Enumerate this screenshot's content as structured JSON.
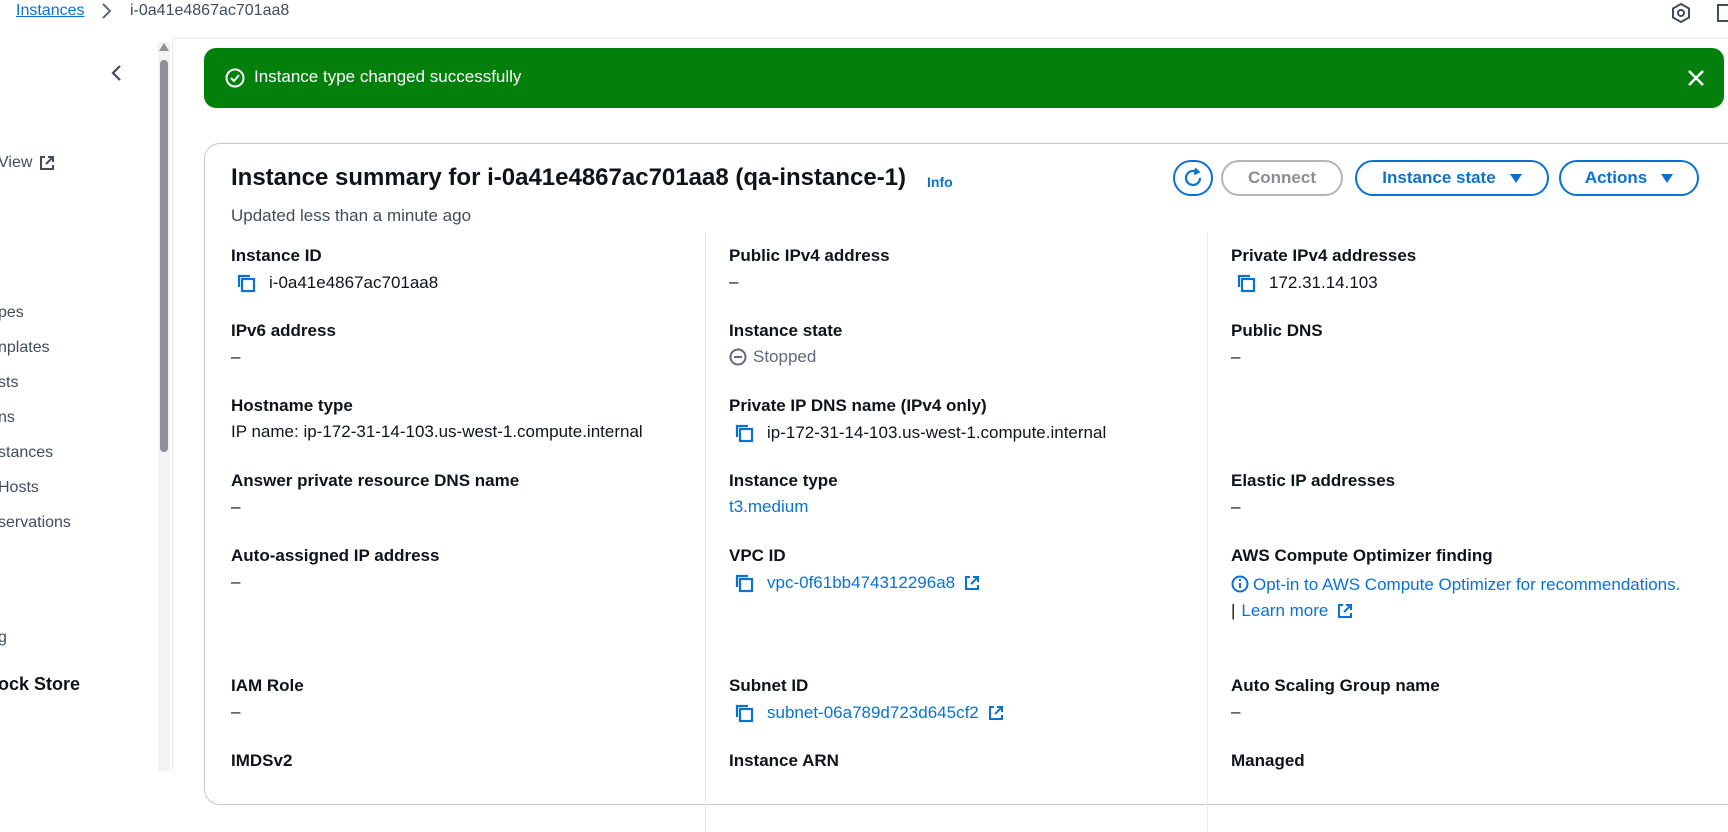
{
  "breadcrumb": {
    "parent": "Instances",
    "current": "i-0a41e4867ac701aa8"
  },
  "sidebar": {
    "items": [
      "View",
      "pes",
      "nplates",
      "sts",
      "ns",
      "stances",
      "Hosts",
      "servations",
      "g",
      "ock Store"
    ]
  },
  "flash": {
    "message": "Instance type changed successfully",
    "color": "#037f0c"
  },
  "summary": {
    "title": "Instance summary for i-0a41e4867ac701aa8 (qa-instance-1)",
    "info": "Info",
    "updated": "Updated less than a minute ago",
    "buttons": {
      "connect": "Connect",
      "instance_state": "Instance state",
      "actions": "Actions"
    },
    "fields": {
      "instance_id": {
        "label": "Instance ID",
        "value": "i-0a41e4867ac701aa8"
      },
      "public_ipv4": {
        "label": "Public IPv4 address",
        "value": "–"
      },
      "private_ipv4": {
        "label": "Private IPv4 addresses",
        "value": "172.31.14.103"
      },
      "ipv6": {
        "label": "IPv6 address",
        "value": "–"
      },
      "instance_state": {
        "label": "Instance state",
        "value": "Stopped"
      },
      "public_dns": {
        "label": "Public DNS",
        "value": "–"
      },
      "hostname_type": {
        "label": "Hostname type",
        "value": "IP name: ip-172-31-14-103.us-west-1.compute.internal"
      },
      "private_dns": {
        "label": "Private IP DNS name (IPv4 only)",
        "value": "ip-172-31-14-103.us-west-1.compute.internal"
      },
      "answer_dns": {
        "label": "Answer private resource DNS name",
        "value": "–"
      },
      "instance_type": {
        "label": "Instance type",
        "value": "t3.medium"
      },
      "elastic_ip": {
        "label": "Elastic IP addresses",
        "value": "–"
      },
      "auto_ip": {
        "label": "Auto-assigned IP address",
        "value": "–"
      },
      "vpc_id": {
        "label": "VPC ID",
        "value": "vpc-0f61bb474312296a8"
      },
      "optimizer": {
        "label": "AWS Compute Optimizer finding",
        "value": "Opt-in to AWS Compute Optimizer for recommendations.",
        "learn_more": "Learn more"
      },
      "iam_role": {
        "label": "IAM Role",
        "value": "–"
      },
      "subnet_id": {
        "label": "Subnet ID",
        "value": "subnet-06a789d723d645cf2"
      },
      "asg_name": {
        "label": "Auto Scaling Group name",
        "value": "–"
      },
      "imdsv2": {
        "label": "IMDSv2"
      },
      "instance_arn": {
        "label": "Instance ARN"
      },
      "managed": {
        "label": "Managed"
      }
    }
  },
  "colors": {
    "link": "#0972d3",
    "success": "#037f0c",
    "text": "#0f141a"
  },
  "icons": [
    "chevron-right-icon",
    "account-icon",
    "window-icon",
    "chevron-left-icon",
    "external-link-icon",
    "success-check-icon",
    "close-icon",
    "refresh-icon",
    "caret-down-icon",
    "copy-icon",
    "stopped-icon",
    "info-icon"
  ]
}
